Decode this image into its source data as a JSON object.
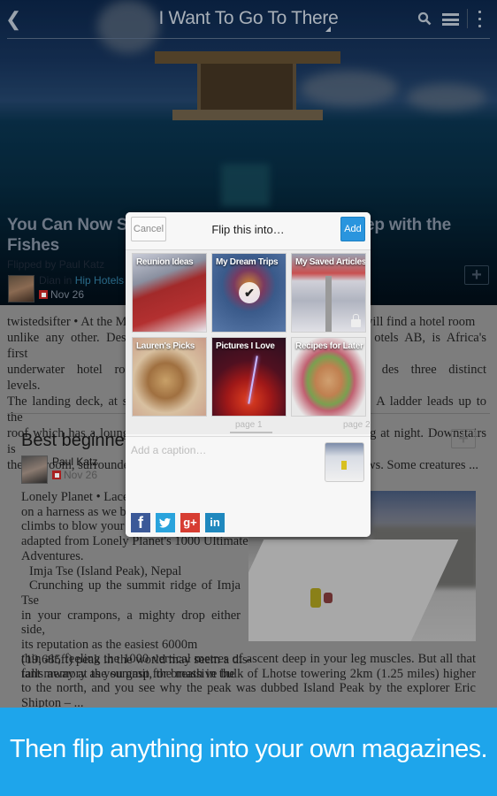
{
  "topbar": {
    "title": "I Want To Go To There",
    "icons": {
      "back": "chevron-left-icon",
      "search": "search-icon",
      "menu": "hamburger-menu-icon",
      "more": "more-vert-icon"
    }
  },
  "hero_article": {
    "headline_left": "You Can Now Stay",
    "headline_left_line2": "Fishes",
    "headline_right": "ep with the",
    "flipped_by": "Flipped by Paul Katz",
    "author": "Dian in",
    "magazine": "Hip Hotels & S",
    "date": "Nov 26",
    "body_lines": [
      "twistedsifter • At the Ma",
      "u will find a hotel room",
      "unlike any other. Design",
      "otels AB, is Africa's first",
      "underwater hotel room.",
      "des three distinct levels.",
      "The landing deck, at sea",
      "A ladder leads up to the",
      "roof which has a loungi",
      "g at night. Downstairs is",
      "the bedroom, surrounde",
      "ws. Some creatures ..."
    ]
  },
  "second_article": {
    "title": "Best beginners",
    "author": "Paul Katz",
    "date": "Nov 26",
    "body_left": [
      "Lonely Planet • Lace",
      "on a harness as we b",
      "climbs to blow your",
      "adapted from Lonely Planet's 1000 Ultimate",
      "Adventures."
    ],
    "subhead": "Imja Tse (Island Peak), Nepal",
    "para_lines": [
      "Crunching up the summit ridge of Imja Tse",
      "in your crampons, a mighty drop either side,",
      "its reputation as the easiest 6000m",
      "(19,685ft) peak in the world may seem a dis-",
      "tant memory as you gasp for breath in the"
    ],
    "full_width_lines": "thin air, feeling the 1000 vertical metres of ascent deep in your leg muscles. But all that falls away at the summit, the massive bulk of Lhotse towering 2km (1.25 miles) higher to the north, and you see why the peak was dubbed Island Peak by the explorer Eric Shipton – ..."
  },
  "flip_dialog": {
    "cancel_label": "Cancel",
    "title": "Flip this into…",
    "add_label": "Add",
    "magazines": [
      {
        "name": "Reunion Ideas",
        "selected": false,
        "private": false
      },
      {
        "name": "My Dream Trips",
        "selected": true,
        "private": false
      },
      {
        "name": "My Saved Articles",
        "selected": false,
        "private": true
      },
      {
        "name": "Lauren's Picks",
        "selected": false,
        "private": false
      },
      {
        "name": "Pictures I Love",
        "selected": false,
        "private": false
      },
      {
        "name": "Recipes for Later",
        "selected": false,
        "private": false
      }
    ],
    "page_label_current": "page 1",
    "page_label_next": "page 2",
    "caption_placeholder": "Add a caption…",
    "caption_value": "",
    "share_targets": [
      {
        "name": "Facebook",
        "glyph": "f",
        "color": "#3b5998"
      },
      {
        "name": "Twitter",
        "glyph": "t",
        "color": "#2aa3dc"
      },
      {
        "name": "Google+",
        "glyph": "g+",
        "color": "#d73d32"
      },
      {
        "name": "LinkedIn",
        "glyph": "in",
        "color": "#1f88be"
      }
    ]
  },
  "banner": {
    "text": "Then flip anything into your own magazines.",
    "color": "#1ea5eb"
  },
  "accent_colors": {
    "add_button": "#2a95de",
    "flipboard_red": "#a82020"
  }
}
